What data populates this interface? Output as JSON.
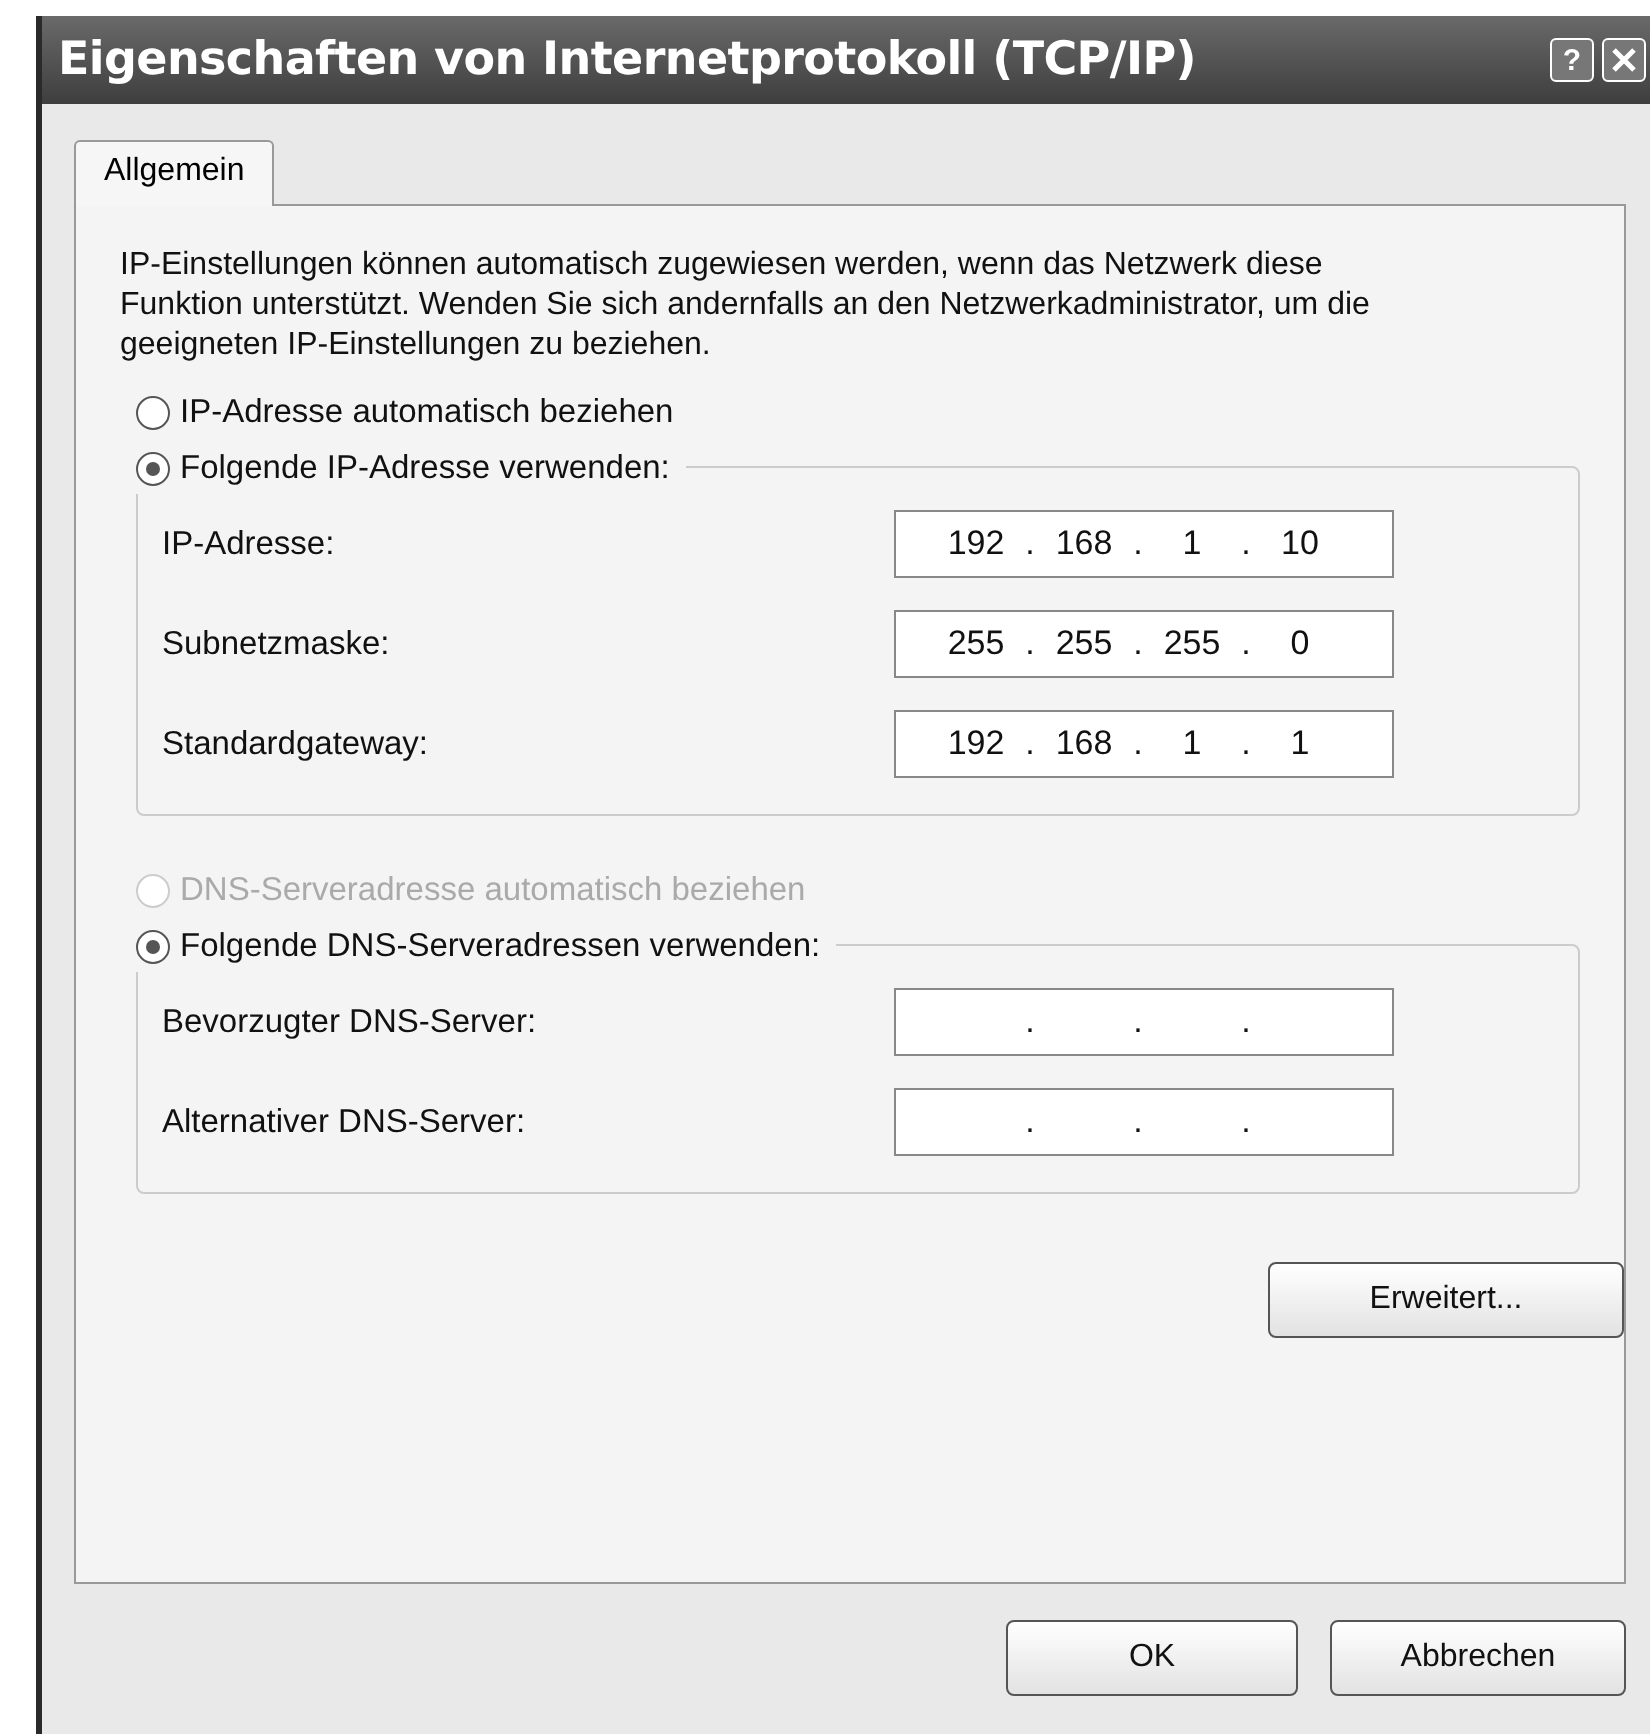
{
  "window": {
    "title": "Eigenschaften von Internetprotokoll (TCP/IP)",
    "help_button": "?"
  },
  "tabs": [
    {
      "label": "Allgemein",
      "selected": true
    }
  ],
  "intro": "IP-Einstellungen können automatisch zugewiesen werden, wenn das Netzwerk diese Funktion unterstützt. Wenden Sie sich andernfalls an den Netzwerkadministrator, um die geeigneten IP-Einstellungen zu beziehen.",
  "sections": [
    {
      "auto_option": {
        "label": "IP-Adresse automatisch beziehen",
        "selected": false,
        "disabled": false
      },
      "manual_option": {
        "label": "Folgende IP-Adresse verwenden:",
        "selected": true,
        "disabled": false
      },
      "fields": [
        {
          "label": "IP-Adresse:",
          "octets": [
            "192",
            "168",
            "1",
            "10"
          ],
          "dots": [
            ".",
            ".",
            "."
          ]
        },
        {
          "label": "Subnetzmaske:",
          "octets": [
            "255",
            "255",
            "255",
            "0"
          ],
          "dots": [
            ".",
            ".",
            "."
          ]
        },
        {
          "label": "Standardgateway:",
          "octets": [
            "192",
            "168",
            "1",
            "1"
          ],
          "dots": [
            ".",
            ".",
            "."
          ]
        }
      ]
    },
    {
      "auto_option": {
        "label": "DNS-Serveradresse automatisch beziehen",
        "selected": false,
        "disabled": true
      },
      "manual_option": {
        "label": "Folgende DNS-Serveradressen verwenden:",
        "selected": true,
        "disabled": false
      },
      "fields": [
        {
          "label": "Bevorzugter DNS-Server:",
          "dots": [
            ".",
            ".",
            "."
          ]
        },
        {
          "label": "Alternativer DNS-Server:",
          "dots": [
            ".",
            ".",
            "."
          ]
        }
      ]
    }
  ],
  "advanced_button": "Erweitert...",
  "buttons": [
    "OK",
    "Abbrechen"
  ]
}
